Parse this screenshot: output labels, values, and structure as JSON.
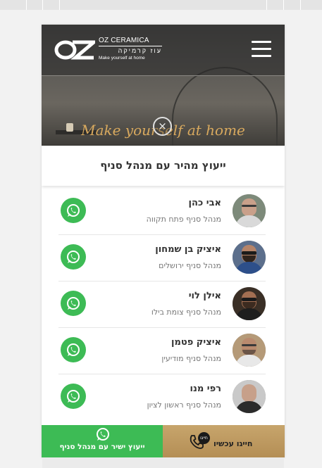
{
  "header": {
    "brand_line1": "OZ CERAMICA",
    "brand_line2": "עוז קרמיקה",
    "brand_line3": "Make yourself at home",
    "menu_icon": "hamburger-icon"
  },
  "hero": {
    "tagline": "Make yourself at home",
    "close_glyph": "×"
  },
  "panel": {
    "title": "ייעוץ מהיר עם מנהל סניף"
  },
  "contacts": [
    {
      "name": "אבי כהן",
      "role": "מנהל סניף פתח תקווה"
    },
    {
      "name": "איציק בן שמחון",
      "role": "מנהל סניף ירושלים"
    },
    {
      "name": "אילן לוי",
      "role": "מנהל סניף צומת בילו"
    },
    {
      "name": "איציק פטמן",
      "role": "מנהל סניף מודיעין"
    },
    {
      "name": "רפי מנו",
      "role": "מנהל סניף ראשון לציון"
    }
  ],
  "bottom_bar": {
    "call_label": "חייגו עכשיו",
    "call_badge": "חייגו",
    "whatsapp_label": "ייעוץ ישיר עם מנהל סניף"
  },
  "colors": {
    "whatsapp_green": "#3dbb55",
    "gold": "#c7a56c",
    "tagline_gold": "#d8a95e"
  }
}
